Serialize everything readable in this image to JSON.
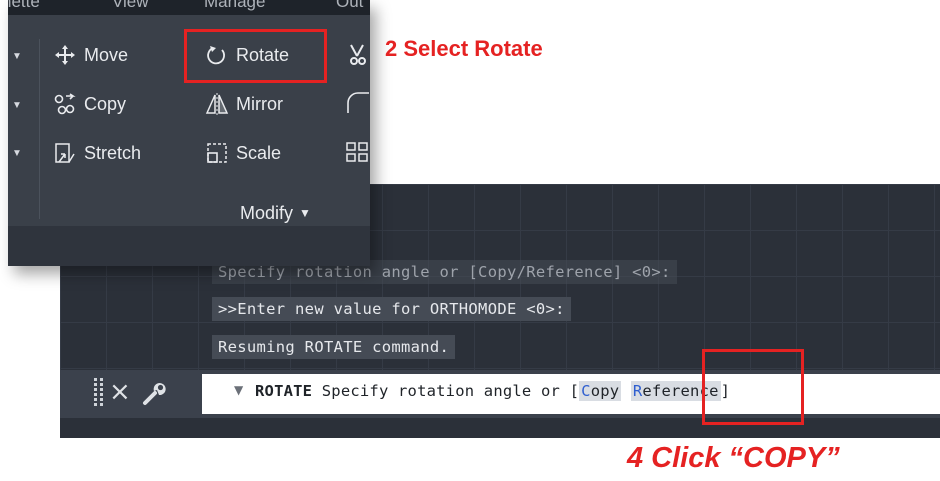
{
  "ribbon": {
    "tabs": [
      "nette",
      "View",
      "Manage",
      "Out"
    ],
    "tools": {
      "move": "Move",
      "rotate": "Rotate",
      "copy": "Copy",
      "mirror": "Mirror",
      "stretch": "Stretch",
      "scale": "Scale"
    },
    "panel_title": "Modify"
  },
  "command_window": {
    "history": [
      "Specify rotation angle or [Copy/Reference] <0>:",
      ">>Enter new value for ORTHOMODE <0>:",
      "Resuming ROTATE command."
    ],
    "prompt": {
      "command": "ROTATE",
      "text": "Specify rotation angle or",
      "bracket_open": "[",
      "option_copy_hotkey": "C",
      "option_copy_rest": "opy",
      "option_reference_hotkey": "R",
      "option_reference_rest": "eference",
      "bracket_close": "]"
    }
  },
  "annotations": {
    "step2": "2 Select Rotate",
    "step4": "4 Click “COPY”"
  },
  "colors": {
    "annotation_red": "#e52222",
    "ribbon_bg": "#3a4049",
    "drawing_bg": "#2b3039",
    "hotkey_blue": "#2f5fd0"
  },
  "icons": [
    "move-icon",
    "rotate-icon",
    "copy-icon",
    "mirror-icon",
    "stretch-icon",
    "scale-icon",
    "trim-icon",
    "fillet-icon",
    "array-icon",
    "close-icon",
    "wrench-icon",
    "grip-icon"
  ]
}
